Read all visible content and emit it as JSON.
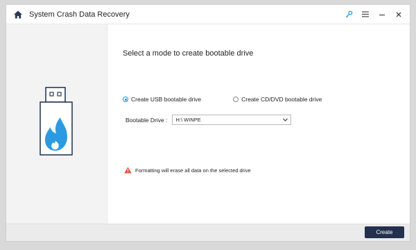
{
  "app": {
    "title": "System Crash Data Recovery"
  },
  "titlebar": {
    "icons": [
      "home-icon",
      "key-icon",
      "menu-icon",
      "minimize-icon",
      "close-icon"
    ]
  },
  "main": {
    "heading": "Select a mode to create bootable drive",
    "options": [
      {
        "label": "Create USB bootable drive",
        "selected": true
      },
      {
        "label": "Create CD/DVD bootable drive",
        "selected": false
      }
    ],
    "drive_label": "Bootable Drive :",
    "drive_value": "H:\\ WINPE",
    "warning": "Formatting will erase all data on the selected drive"
  },
  "footer": {
    "create_label": "Create"
  },
  "colors": {
    "accent": "#1a8fe6",
    "usb_blue": "#2a9be3",
    "button_bg": "#22314e",
    "warning_red": "#e84d3d"
  }
}
